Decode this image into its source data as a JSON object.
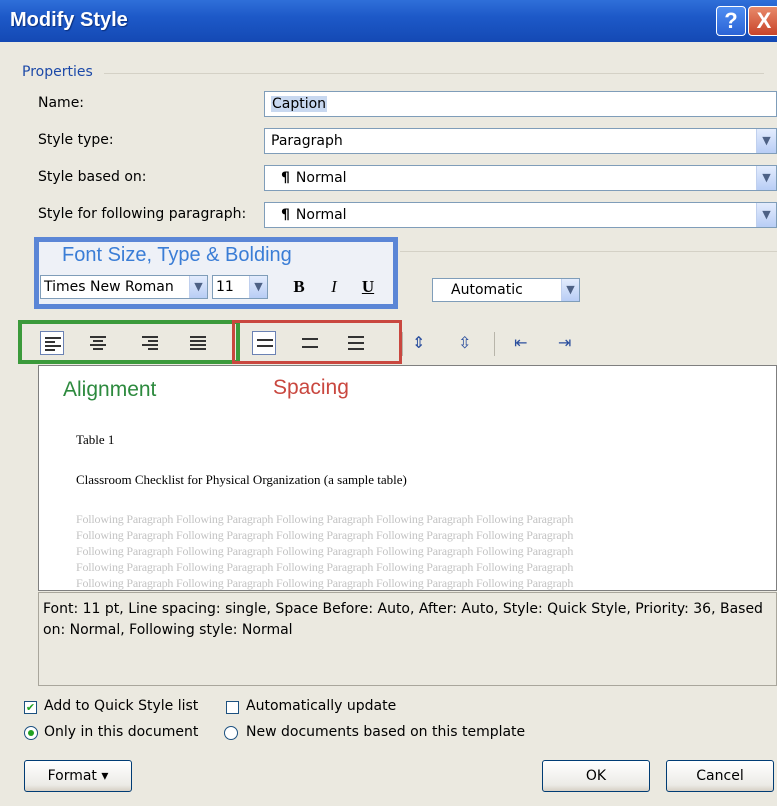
{
  "window": {
    "title": "Modify Style",
    "help_glyph": "?",
    "close_glyph": "X"
  },
  "properties": {
    "section_label": "Properties",
    "name_label": "Name:",
    "name_value": "Caption",
    "style_type_label": "Style type:",
    "style_type_value": "Paragraph",
    "based_on_label": "Style based on:",
    "based_on_value": "Normal",
    "following_label": "Style for following paragraph:",
    "following_value": "Normal",
    "para_glyph": "¶"
  },
  "formatting": {
    "font_name": "Times New Roman",
    "font_size": "11",
    "bold_glyph": "B",
    "italic_glyph": "I",
    "underline_glyph": "U",
    "color_value": "Automatic",
    "dropdown_glyph": "▼"
  },
  "annotations": {
    "font_group": "Font Size, Type & Bolding",
    "alignment": "Alignment",
    "spacing": "Spacing"
  },
  "preview": {
    "heading1": "Table 1",
    "heading2": "Classroom Checklist for Physical Organization (a sample table)",
    "following_text": "Following Paragraph Following Paragraph Following Paragraph Following Paragraph Following Paragraph"
  },
  "description": "Font: 11 pt, Line spacing:  single, Space Before:  Auto, After:  Auto, Style: Quick Style, Priority: 36, Based on: Normal, Following style: Normal",
  "options": {
    "add_quick_style": "Add to Quick Style list",
    "auto_update": "Automatically update",
    "only_this_doc": "Only in this document",
    "new_docs": "New documents based on this template"
  },
  "buttons": {
    "format": "Format",
    "format_arrow": "▾",
    "ok": "OK",
    "cancel": "Cancel"
  },
  "colors": {
    "title_bar": "#1d59c8",
    "green_box": "#3b9a3b",
    "red_box": "#c9473f",
    "blue_box": "#5b86d6"
  }
}
